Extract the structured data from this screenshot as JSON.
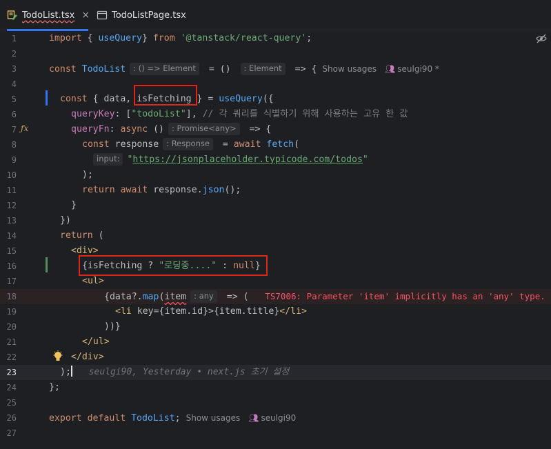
{
  "tabs": [
    {
      "name": "TodoList.tsx",
      "close": "×",
      "active": true
    },
    {
      "name": "TodoListPage.tsx",
      "active": false
    }
  ],
  "editor": {
    "line_numbers": [
      "1",
      "2",
      "3",
      "4",
      "5",
      "6",
      "7",
      "8",
      "9",
      "10",
      "11",
      "12",
      "13",
      "14",
      "15",
      "16",
      "17",
      "18",
      "19",
      "20",
      "21",
      "22",
      "23",
      "24",
      "25",
      "26",
      "27"
    ],
    "current_line": "23",
    "l1": {
      "import": "import",
      "ob": " { ",
      "name": "useQuery",
      "cb": "} ",
      "from": "from",
      "src": " '@tanstack/react-query'",
      "semi": ";"
    },
    "l3": {
      "const": "const",
      "name": "TodoList",
      "hint1": ": () => Element",
      "eq": " = () ",
      "hint2": ": Element",
      "arrow": " => {",
      "usage": "Show usages",
      "author": "seulgi90 *"
    },
    "l5": {
      "const": "const",
      "ob": " { ",
      "data": "data",
      "comma": ", ",
      "isFetching": "isFetching",
      "cb": " } = ",
      "useQuery": "useQuery",
      "rest": "({"
    },
    "l6": {
      "key": "queryKey",
      "colon": ": [",
      "val": "\"todoList\"",
      "close": "], ",
      "comment": "// 각 쿼리를 식별하기 위해 사용하는 고유 한 값"
    },
    "l7": {
      "key": "queryFn",
      "colon": ": ",
      "async": "async",
      "parens": " ()",
      "hint": ": Promise<any>",
      "arrow": " => {"
    },
    "l8": {
      "const": "const",
      "name": " response",
      "hint": ": Response",
      "eq": " = ",
      "await": "await",
      "fetch": " fetch",
      "paren": "("
    },
    "l9": {
      "hint": "input:",
      "q1": "\"",
      "url": "https://jsonplaceholder.typicode.com/todos",
      "q2": "\""
    },
    "l10": {
      "text": ");"
    },
    "l11": {
      "return": "return",
      "await": " await",
      "rest": " response.",
      "json": "json",
      "end": "();"
    },
    "l12": {
      "text": "}"
    },
    "l13": {
      "text": "})"
    },
    "l14": {
      "return": "return",
      "rest": " ("
    },
    "l15": {
      "tag": "<div>"
    },
    "l16": {
      "ob": "{",
      "var": "isFetching",
      "q": " ? ",
      "str": "\"로딩중....\"",
      "colon": " : ",
      "null": "null",
      "cb": "}"
    },
    "l17": {
      "tag": "<ul>"
    },
    "l18": {
      "ob": "{",
      "data": "data",
      "opt": "?.",
      "map": "map",
      "paren": "(",
      "item": "item",
      "hint": ": any",
      "arrow": " => (",
      "error": "TS7006: Parameter 'item' implicitly has an 'any' type."
    },
    "l19": {
      "open": "<li",
      "key": " key",
      "eq": "={",
      "v1": "item.id",
      "c1": "}>",
      "ob": "{",
      "v2": "item.title",
      "cb": "}",
      "close": "</li>"
    },
    "l20": {
      "text": "))}"
    },
    "l21": {
      "tag": "</ul>"
    },
    "l22": {
      "tag": "</div>"
    },
    "l23": {
      "text": ");",
      "blame": "seulgi90, Yesterday • next.js 초기 설정"
    },
    "l24": {
      "text": "};"
    },
    "l26": {
      "export": "export",
      "default": " default",
      "name": " TodoList",
      "semi": ";",
      "usage": "Show usages",
      "author": "seulgi90"
    }
  },
  "colors": {
    "highlight_box": "#e0251b",
    "accent": "#3574f0"
  },
  "icons": [
    "tsx-file-icon",
    "file-icon",
    "close-icon",
    "reader-mode-icon",
    "function-gutter-icon",
    "lightbulb-icon",
    "user-icon"
  ]
}
